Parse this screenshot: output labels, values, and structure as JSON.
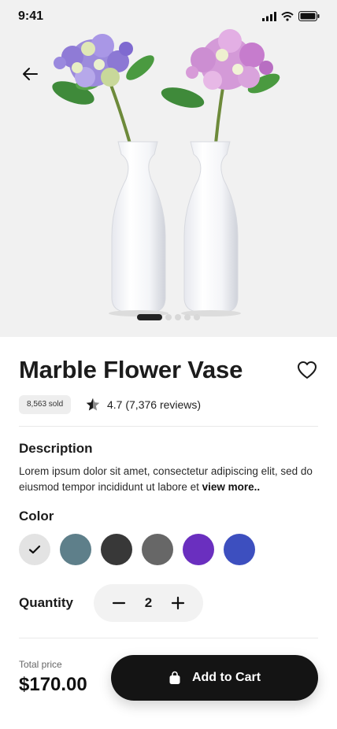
{
  "status_bar": {
    "time": "9:41"
  },
  "product": {
    "title": "Marble Flower Vase",
    "sold_badge": "8,563 sold",
    "rating": "4.7 (7,376 reviews)",
    "image_count": 5,
    "active_image": 1
  },
  "description": {
    "heading": "Description",
    "text": "Lorem ipsum dolor sit amet, consectetur adipiscing elit, sed do eiusmod tempor incididunt ut labore et ",
    "more_link": "view more.."
  },
  "color": {
    "heading": "Color",
    "selected_index": 0,
    "options": [
      "#e3e3e3",
      "#5e7f8a",
      "#383838",
      "#676767",
      "#6a2fbf",
      "#3d4fbf"
    ]
  },
  "quantity": {
    "label": "Quantity",
    "value": "2"
  },
  "checkout": {
    "total_label": "Total price",
    "total_price": "$170.00",
    "add_to_cart": "Add to Cart"
  }
}
